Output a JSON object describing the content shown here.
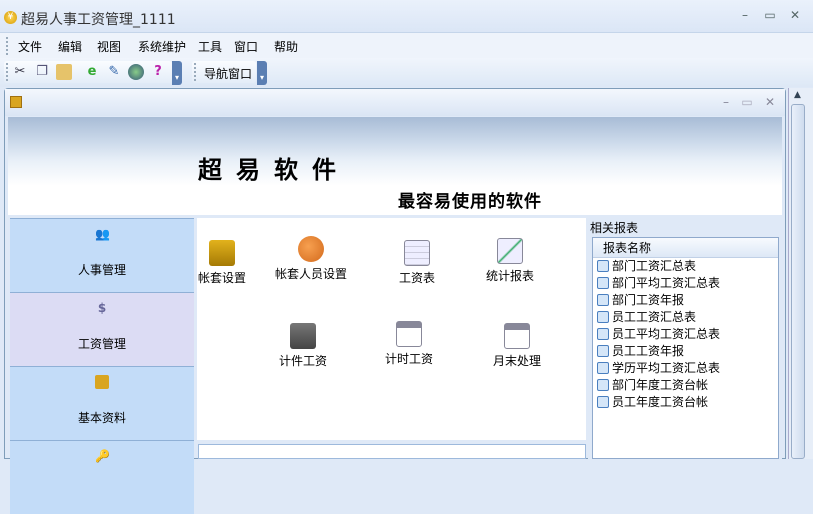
{
  "window": {
    "title": "超易人事工资管理_1111",
    "minimize": "–",
    "maximize": "▭",
    "close": "✕"
  },
  "menu": [
    "文件",
    "编辑",
    "视图",
    "系统维护",
    "工具",
    "窗口",
    "帮助"
  ],
  "toolbar": {
    "icons": [
      "cut-icon",
      "copy-icon",
      "paste-icon",
      "refresh-icon",
      "edit-icon",
      "globe-icon",
      "help-icon"
    ],
    "help_glyph": "?",
    "nav_window": "导航窗口"
  },
  "banner": {
    "title": "超易软件",
    "subtitle": "最容易使用的软件"
  },
  "nav": [
    {
      "label": "人事管理",
      "icon": "users-icon"
    },
    {
      "label": "工资管理",
      "icon": "salary-icon",
      "selected": true
    },
    {
      "label": "基本资料",
      "icon": "document-icon"
    }
  ],
  "functions": [
    "帐套设置",
    "帐套人员设置",
    "工资表",
    "统计报表",
    "计件工资",
    "计时工资",
    "月末处理"
  ],
  "reports": {
    "title": "相关报表",
    "header": "报表名称",
    "items": [
      "部门工资汇总表",
      "部门平均工资汇总表",
      "部门工资年报",
      "员工工资汇总表",
      "员工平均工资汇总表",
      "员工工资年报",
      "学历平均工资汇总表",
      "部门年度工资台帐",
      "员工年度工资台帐"
    ]
  }
}
